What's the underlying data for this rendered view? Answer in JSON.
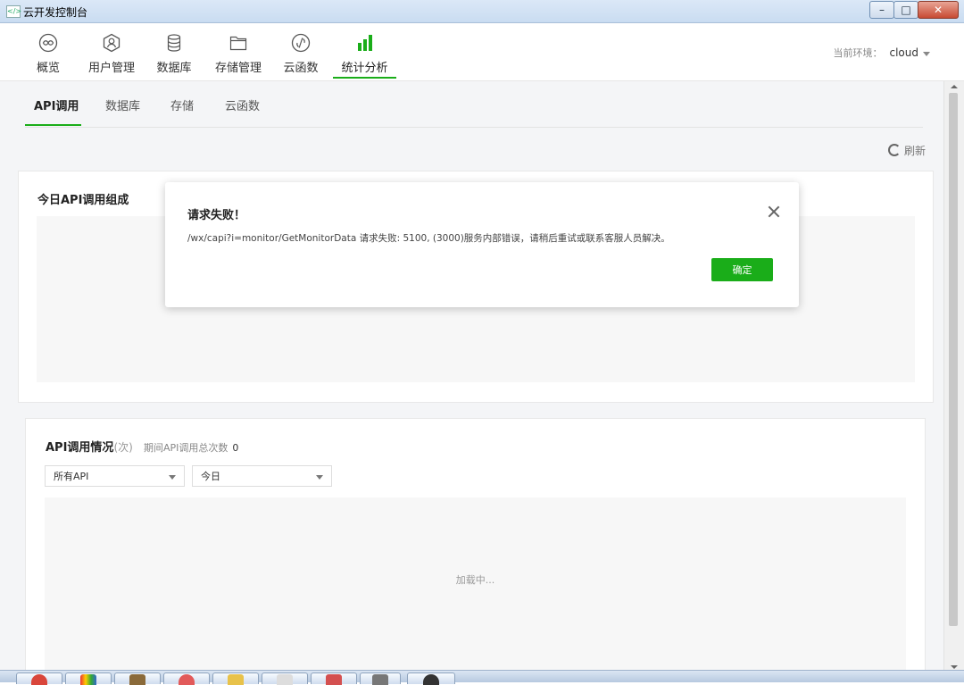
{
  "window": {
    "title": "云开发控制台"
  },
  "nav": {
    "items": [
      {
        "label": "概览",
        "icon": "overview-icon"
      },
      {
        "label": "用户管理",
        "icon": "user-management-icon"
      },
      {
        "label": "数据库",
        "icon": "database-icon"
      },
      {
        "label": "存储管理",
        "icon": "storage-folder-icon"
      },
      {
        "label": "云函数",
        "icon": "cloud-function-icon"
      },
      {
        "label": "统计分析",
        "icon": "statistics-bar-icon",
        "active": true
      }
    ],
    "env_label": "当前环境：",
    "env_value": "cloud"
  },
  "subtabs": [
    {
      "label": "API调用",
      "active": true
    },
    {
      "label": "数据库"
    },
    {
      "label": "存储"
    },
    {
      "label": "云函数"
    }
  ],
  "refresh_label": "刷新",
  "card_today": {
    "title": "今日API调用组成"
  },
  "card_usage": {
    "title": "API调用情况",
    "unit": "(次)",
    "total_label": "期间API调用总次数",
    "total_value": "0",
    "api_select": "所有API",
    "range_select": "今日",
    "loading_text": "加载中..."
  },
  "modal": {
    "title": "请求失败！",
    "message": "/wx/capi?i=monitor/GetMonitorData 请求失败: 5100, (3000)服务内部错误，请稍后重试或联系客服人员解决。",
    "confirm_label": "确定"
  },
  "colors": {
    "accent": "#1aad19"
  }
}
